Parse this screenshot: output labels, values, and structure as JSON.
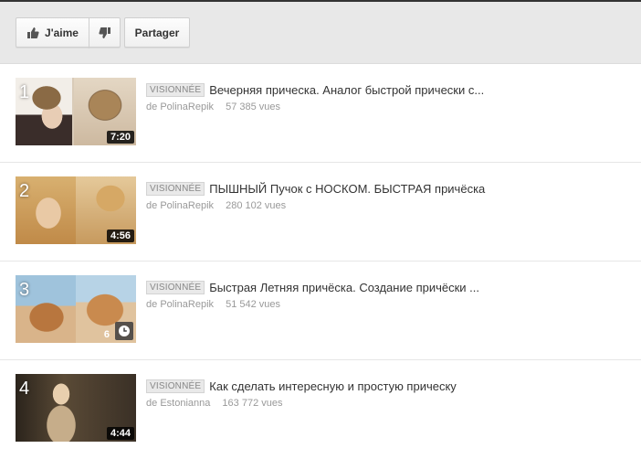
{
  "actions": {
    "like_label": "J'aime",
    "share_label": "Partager"
  },
  "playlist": [
    {
      "index": "1",
      "badge": "VISIONNÉE",
      "title": "Вечерняя прическа. Аналог быстрой прически с...",
      "by": "de",
      "author": "PolinaRepik",
      "views": "57 385 vues",
      "duration": "7:20"
    },
    {
      "index": "2",
      "badge": "VISIONNÉE",
      "title": "ПЫШНЫЙ Пучок с НОСКОМ. БЫСТРАЯ причёска",
      "by": "de",
      "author": "PolinaRepik",
      "views": "280 102 vues",
      "duration": "4:56"
    },
    {
      "index": "3",
      "badge": "VISIONNÉE",
      "title": "Быстрая Летняя причёска. Создание причёски ...",
      "by": "de",
      "author": "PolinaRepik",
      "views": "51 542 vues",
      "duration": "6",
      "overlay_icon": "clock-icon"
    },
    {
      "index": "4",
      "badge": "VISIONNÉE",
      "title": "Как сделать интересную и простую прическу",
      "by": "de",
      "author": "Estonianna",
      "views": "163 772 vues",
      "duration": "4:44"
    }
  ],
  "icons": {
    "like": "thumbs-up-icon",
    "dislike": "thumbs-down-icon",
    "watch_later": "clock-icon"
  }
}
